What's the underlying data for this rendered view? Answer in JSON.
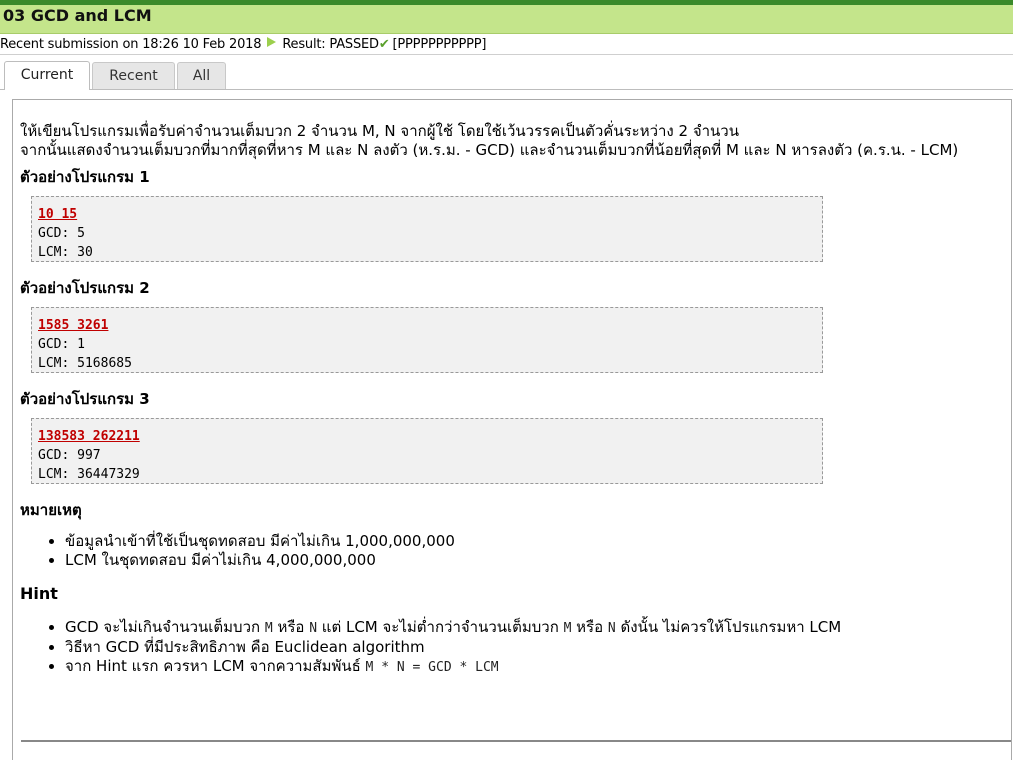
{
  "title": "03 GCD and LCM",
  "submission": {
    "prefix": "Recent submission on 18:26 10 Feb 2018",
    "result": "Result: PASSED",
    "codes": "[PPPPPPPPPPP]"
  },
  "tabs": [
    {
      "label": "Current"
    },
    {
      "label": "Recent"
    },
    {
      "label": "All"
    }
  ],
  "intro": {
    "line1": "ให้เขียนโปรแกรมเพื่อรับค่าจำนวนเต็มบวก 2 จำนวน M, N จากผู้ใช้ โดยใช้เว้นวรรคเป็นตัวคั่นระหว่าง 2 จำนวน",
    "line2": "จากนั้นแสดงจำนวนเต็มบวกที่มากที่สุดที่หาร M และ N ลงตัว (ห.ร.ม. - GCD) และจำนวนเต็มบวกที่น้อยที่สุดที่ M และ N หารลงตัว (ค.ร.น. - LCM)"
  },
  "samples": [
    {
      "heading": "ตัวอย่างโปรแกรม 1",
      "input": "10 15",
      "gcd": "GCD: 5",
      "lcm": "LCM: 30"
    },
    {
      "heading": "ตัวอย่างโปรแกรม 2",
      "input": "1585 3261",
      "gcd": "GCD: 1",
      "lcm": "LCM: 5168685"
    },
    {
      "heading": "ตัวอย่างโปรแกรม 3",
      "input": "138583 262211",
      "gcd": "GCD: 997",
      "lcm": "LCM: 36447329"
    }
  ],
  "notes": {
    "heading": "หมายเหตุ",
    "items": [
      "ข้อมูลนำเข้าที่ใช้เป็นชุดทดสอบ มีค่าไม่เกิน 1,000,000,000",
      "LCM ในชุดทดสอบ มีค่าไม่เกิน 4,000,000,000"
    ]
  },
  "hint": {
    "heading": "Hint",
    "item1": {
      "a": "GCD จะไม่เกินจำนวนเต็มบวก ",
      "m": "M",
      "b": " หรือ ",
      "n": "N",
      "c": " แต่ LCM จะไม่ต่ำกว่าจำนวนเต็มบวก ",
      "m2": "M",
      "d": " หรือ ",
      "n2": "N",
      "e": " ดังนั้น ไม่ควรให้โปรแกรมหา LCM"
    },
    "item2": "วิธีหา GCD ที่มีประสิทธิภาพ คือ Euclidean algorithm",
    "item3": {
      "a": "จาก Hint แรก ควรหา LCM จากความสัมพันธ์ ",
      "code": "M * N = GCD * LCM"
    }
  }
}
